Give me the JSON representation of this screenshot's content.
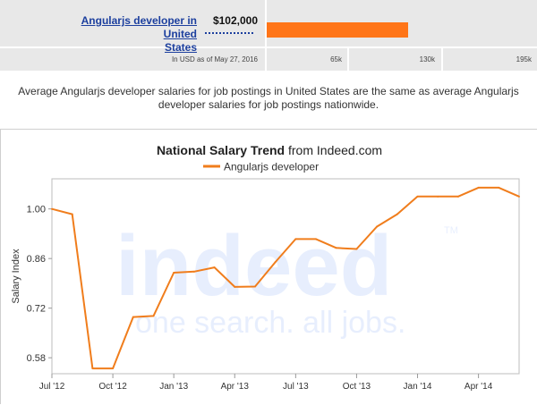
{
  "salary_summary": {
    "job_title_line1": "Angularjs developer in United",
    "job_title_line2": "States",
    "salary": "$102,000",
    "salary_bar_fraction": 0.523,
    "currency_note": "In USD as of May 27, 2016",
    "scale_ticks": [
      "65k",
      "130k",
      "195k"
    ],
    "bar_color": "#ff7518"
  },
  "comparison_text_line1": "Average Angularjs developer salaries for job postings in United States are the same as average Angularjs",
  "comparison_text_line2": "developer salaries for job postings nationwide.",
  "chart_data": {
    "type": "line",
    "title_bold": "National Salary Trend",
    "title_rest": " from Indeed.com",
    "ylabel": "Salary Index",
    "ylim": [
      0.535,
      1.085
    ],
    "y_ticks": [
      "0.58",
      "0.72",
      "0.86",
      "1.00"
    ],
    "x_ticks": [
      "Jul '12",
      "Oct '12",
      "Jan '13",
      "Apr '13",
      "Jul '13",
      "Oct '13",
      "Jan '14",
      "Apr '14"
    ],
    "legend_position": "top-center",
    "watermark": "indeed",
    "watermark_tagline": "one search. all jobs.",
    "series": [
      {
        "name": "Angularjs developer",
        "color": "#f07d1c",
        "x": [
          "Jul '12",
          "Aug '12",
          "Sep '12",
          "Oct '12",
          "Nov '12",
          "Dec '12",
          "Jan '13",
          "Feb '13",
          "Mar '13",
          "Apr '13",
          "May '13",
          "Jun '13",
          "Jul '13",
          "Aug '13",
          "Sep '13",
          "Oct '13",
          "Nov '13",
          "Dec '13",
          "Jan '14",
          "Feb '14",
          "Mar '14",
          "Apr '14",
          "May '14",
          "Jun '14"
        ],
        "values": [
          1.0,
          0.985,
          0.55,
          0.55,
          0.695,
          0.698,
          0.82,
          0.823,
          0.835,
          0.78,
          0.781,
          0.85,
          0.915,
          0.915,
          0.89,
          0.887,
          0.95,
          0.985,
          1.035,
          1.035,
          1.035,
          1.06,
          1.06,
          1.035
        ]
      }
    ]
  }
}
